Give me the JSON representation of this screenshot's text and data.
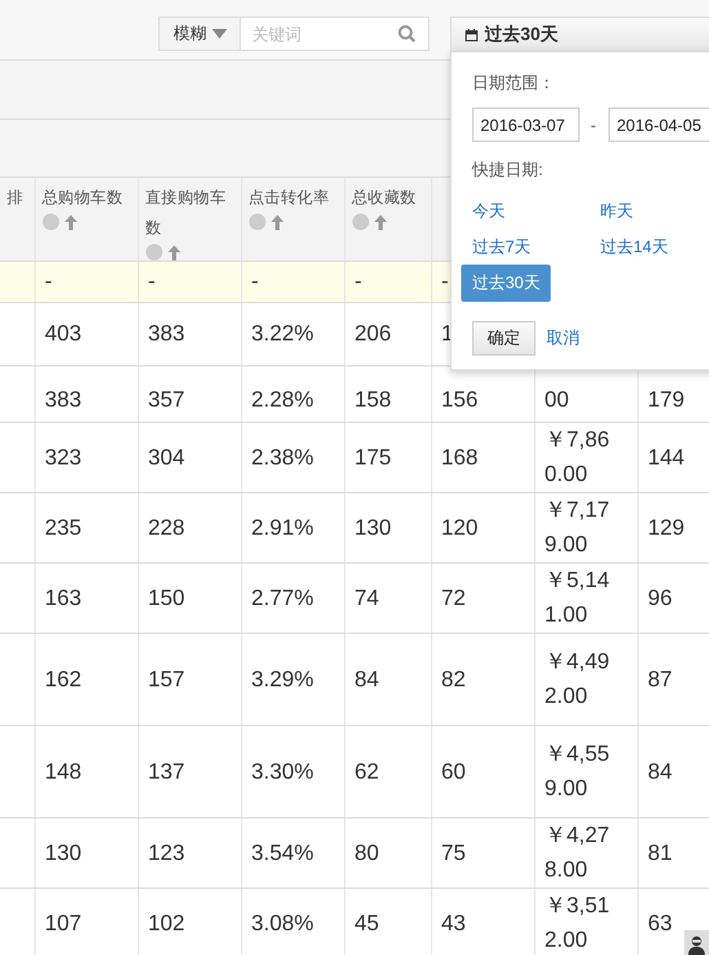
{
  "search": {
    "mode": "模糊",
    "placeholder": "关键词"
  },
  "date_picker": {
    "button": "过去30天",
    "range_label": "日期范围：",
    "start": "2016-03-07",
    "separator": "-",
    "end": "2016-04-05",
    "quick_label": "快捷日期:",
    "quick": [
      {
        "label": "今天",
        "selected": false
      },
      {
        "label": "昨天",
        "selected": false
      },
      {
        "label": "过去7天",
        "selected": false
      },
      {
        "label": "过去14天",
        "selected": false
      },
      {
        "label": "过去30天",
        "selected": true
      }
    ],
    "confirm": "确定",
    "cancel": "取消"
  },
  "table": {
    "columns": [
      {
        "label": "排",
        "kind": "plain"
      },
      {
        "label": "总购物车数",
        "kind": "sortable"
      },
      {
        "label": "直接购物车数",
        "kind": "sortable"
      },
      {
        "label": "点击转化率",
        "kind": "sortable"
      },
      {
        "label": "总收藏数",
        "kind": "sortable"
      }
    ],
    "rows": [
      {
        "kind": "summary",
        "cells": [
          "",
          "-",
          "-",
          "-",
          "-",
          "-"
        ]
      },
      {
        "kind": "data",
        "cells": [
          "",
          "403",
          "383",
          "3.22%",
          "206",
          "1"
        ]
      },
      {
        "kind": "data",
        "cells": [
          "",
          "383",
          "357",
          "2.28%",
          "158",
          "156",
          "00",
          "179"
        ]
      },
      {
        "kind": "data",
        "cells": [
          "",
          "323",
          "304",
          "2.38%",
          "175",
          "168",
          "￥7,860.00",
          "144"
        ]
      },
      {
        "kind": "data",
        "cells": [
          "",
          "235",
          "228",
          "2.91%",
          "130",
          "120",
          "￥7,179.00",
          "129"
        ]
      },
      {
        "kind": "data",
        "cells": [
          "",
          "163",
          "150",
          "2.77%",
          "74",
          "72",
          "￥5,141.00",
          "96"
        ]
      },
      {
        "kind": "data",
        "cells": [
          "",
          "162",
          "157",
          "3.29%",
          "84",
          "82",
          "￥4,492.00",
          "87"
        ]
      },
      {
        "kind": "data",
        "cells": [
          "",
          "148",
          "137",
          "3.30%",
          "62",
          "60",
          "￥4,559.00",
          "84"
        ]
      },
      {
        "kind": "data",
        "cells": [
          "",
          "130",
          "123",
          "3.54%",
          "80",
          "75",
          "￥4,278.00",
          "81"
        ]
      },
      {
        "kind": "data",
        "cells": [
          "",
          "107",
          "102",
          "3.08%",
          "45",
          "43",
          "￥3,512.00",
          "63"
        ]
      }
    ]
  }
}
